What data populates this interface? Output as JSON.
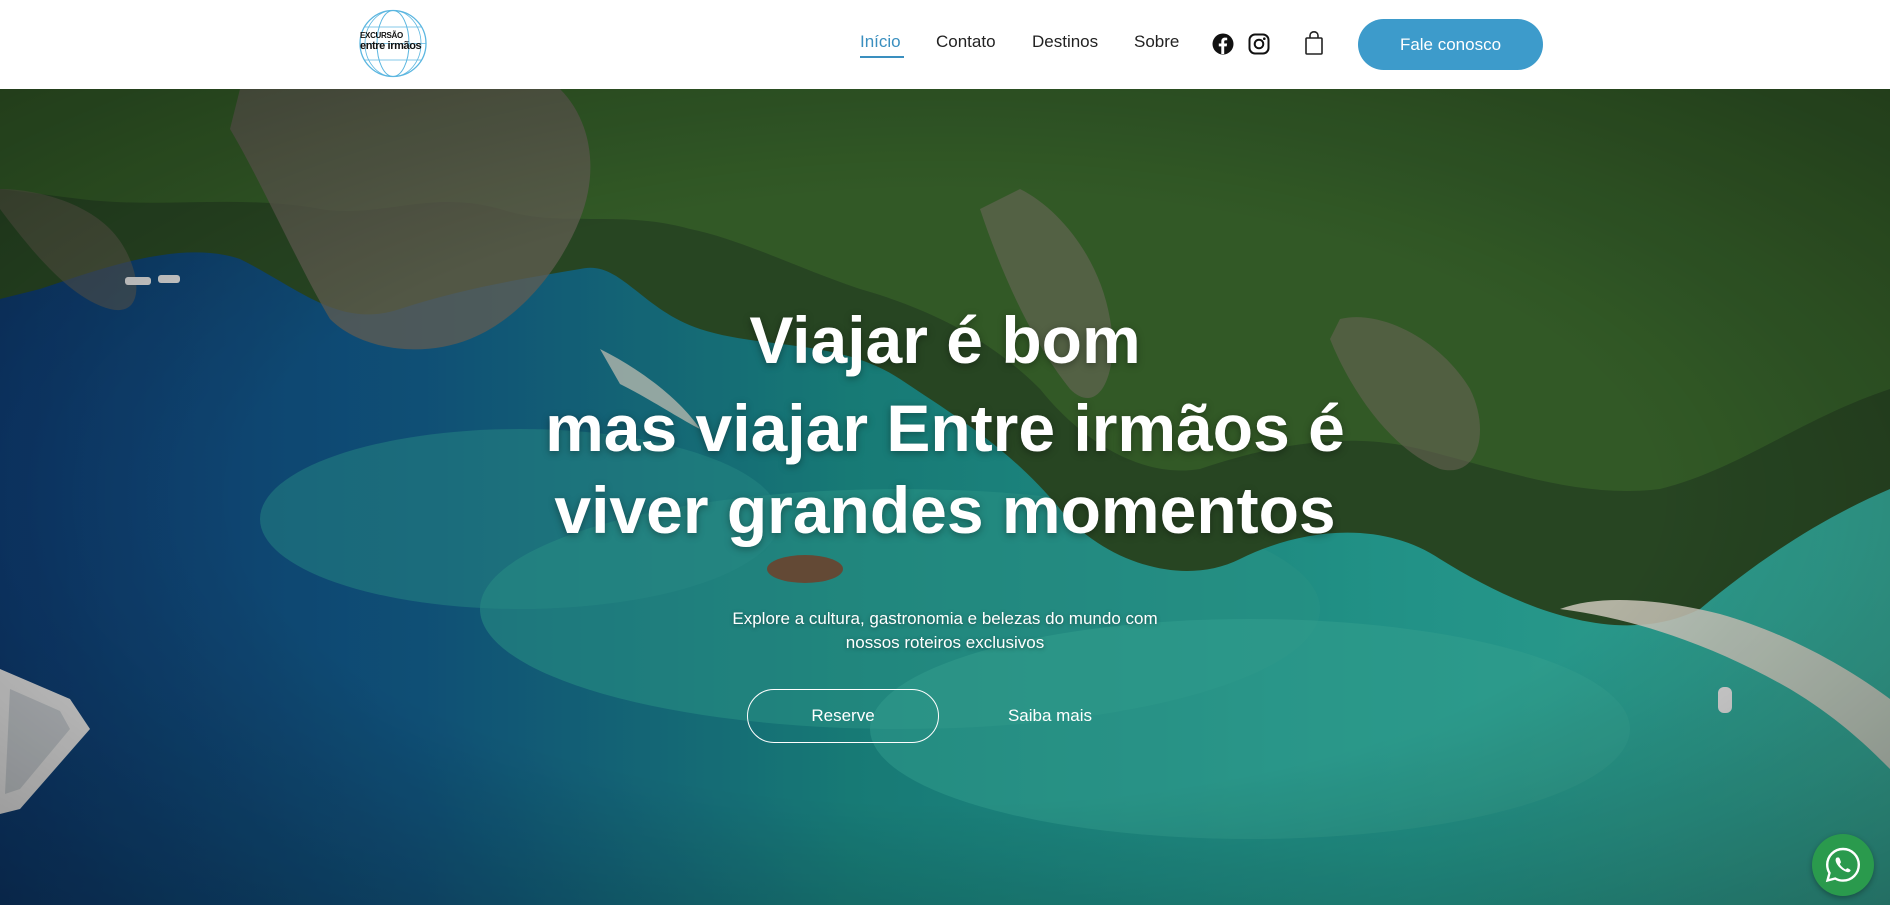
{
  "header": {
    "logo": {
      "line1": "EXCURSÃO",
      "line2": "entre irmãos"
    },
    "nav": [
      {
        "label": "Início",
        "active": true
      },
      {
        "label": "Contato",
        "active": false
      },
      {
        "label": "Destinos",
        "active": false
      },
      {
        "label": "Sobre",
        "active": false
      }
    ],
    "social_icons": [
      "facebook-icon",
      "instagram-icon"
    ],
    "cart_icon": "shopping-bag-icon",
    "cta_label": "Fale conosco"
  },
  "hero": {
    "title_lines": [
      "Viajar é bom",
      "mas viajar Entre irmãos é",
      "viver grandes momentos"
    ],
    "subtitle_line1": "Explore a cultura, gastronomia e belezas do mundo com",
    "subtitle_line2": "nossos roteiros exclusivos",
    "reserve_label": "Reserve",
    "learn_more_label": "Saiba mais"
  },
  "floating": {
    "whatsapp_icon": "whatsapp-icon"
  },
  "colors": {
    "accent": "#3d9bcb",
    "active_nav": "#3a8fbf",
    "whatsapp": "#2a9a4d",
    "header_bg": "#ffffff",
    "text": "#222222"
  }
}
